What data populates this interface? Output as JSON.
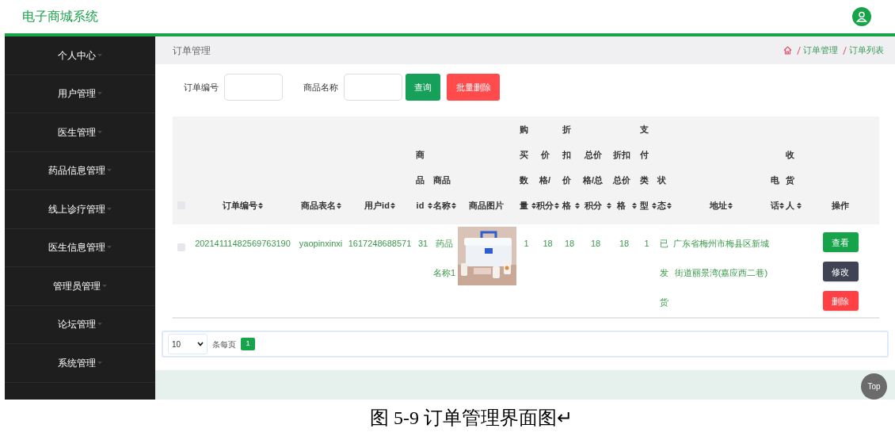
{
  "app_title": "电子商城系统",
  "sidebar": {
    "items": [
      {
        "label": "个人中心"
      },
      {
        "label": "用户管理"
      },
      {
        "label": "医生管理"
      },
      {
        "label": "药品信息管理"
      },
      {
        "label": "线上诊疗管理"
      },
      {
        "label": "医生信息管理"
      },
      {
        "label": "管理员管理"
      },
      {
        "label": "论坛管理"
      },
      {
        "label": "系统管理"
      }
    ]
  },
  "page_title": "订单管理",
  "breadcrumb": [
    "订单管理",
    "订单列表"
  ],
  "search": {
    "fields": [
      {
        "label": "订单编号"
      },
      {
        "label": "商品名称"
      }
    ],
    "buttons": [
      {
        "kind": "query",
        "label": "查询"
      },
      {
        "kind": "batch_delete",
        "label": "批量删除"
      }
    ]
  },
  "table": {
    "select_all_checked": false,
    "columns": [
      {
        "label": "订单编号",
        "sortable": true
      },
      {
        "label": "商品表名",
        "sortable": true
      },
      {
        "label": "用户id",
        "sortable": true
      },
      {
        "label": "商品id",
        "sortable": true
      },
      {
        "label": "商品名称",
        "sortable": true
      },
      {
        "label": "商品图片",
        "sortable": false
      },
      {
        "label": "购买数量",
        "sortable": true
      },
      {
        "label": "价格/积分",
        "sortable": true
      },
      {
        "label": "折扣价格",
        "sortable": true
      },
      {
        "label": "总价格/总积分",
        "sortable": true
      },
      {
        "label": "折扣总价格",
        "sortable": true
      },
      {
        "label": "支付类型",
        "sortable": true
      },
      {
        "label": "状态",
        "sortable": true
      },
      {
        "label": "地址",
        "sortable": true
      },
      {
        "label": "电话",
        "sortable": true
      },
      {
        "label": "收货人",
        "sortable": true
      },
      {
        "label": "操作",
        "sortable": false
      }
    ],
    "rows": [
      {
        "checked": false,
        "cells": [
          "20214111482569763190",
          "yaopinxinxi",
          "1617248688571",
          "31",
          "药品名称1",
          {
            "kind": "picture"
          },
          "1",
          "18",
          "18",
          "18",
          "18",
          "1",
          "已发货",
          "广东省梅州市梅县区新城街道丽景湾(嘉应西二巷)"
        ],
        "actions": [
          {
            "kind": "view",
            "label": "查看"
          },
          {
            "kind": "edit",
            "label": "修改"
          },
          {
            "kind": "delete",
            "label": "删除"
          }
        ]
      }
    ]
  },
  "pagination": {
    "page_size": "10",
    "page_size_label": "条每页",
    "pages": [
      {
        "label": "1",
        "selected": true
      }
    ]
  },
  "back_to_top": "Top",
  "caption": "图 5-9 订单管理界面图↵"
}
